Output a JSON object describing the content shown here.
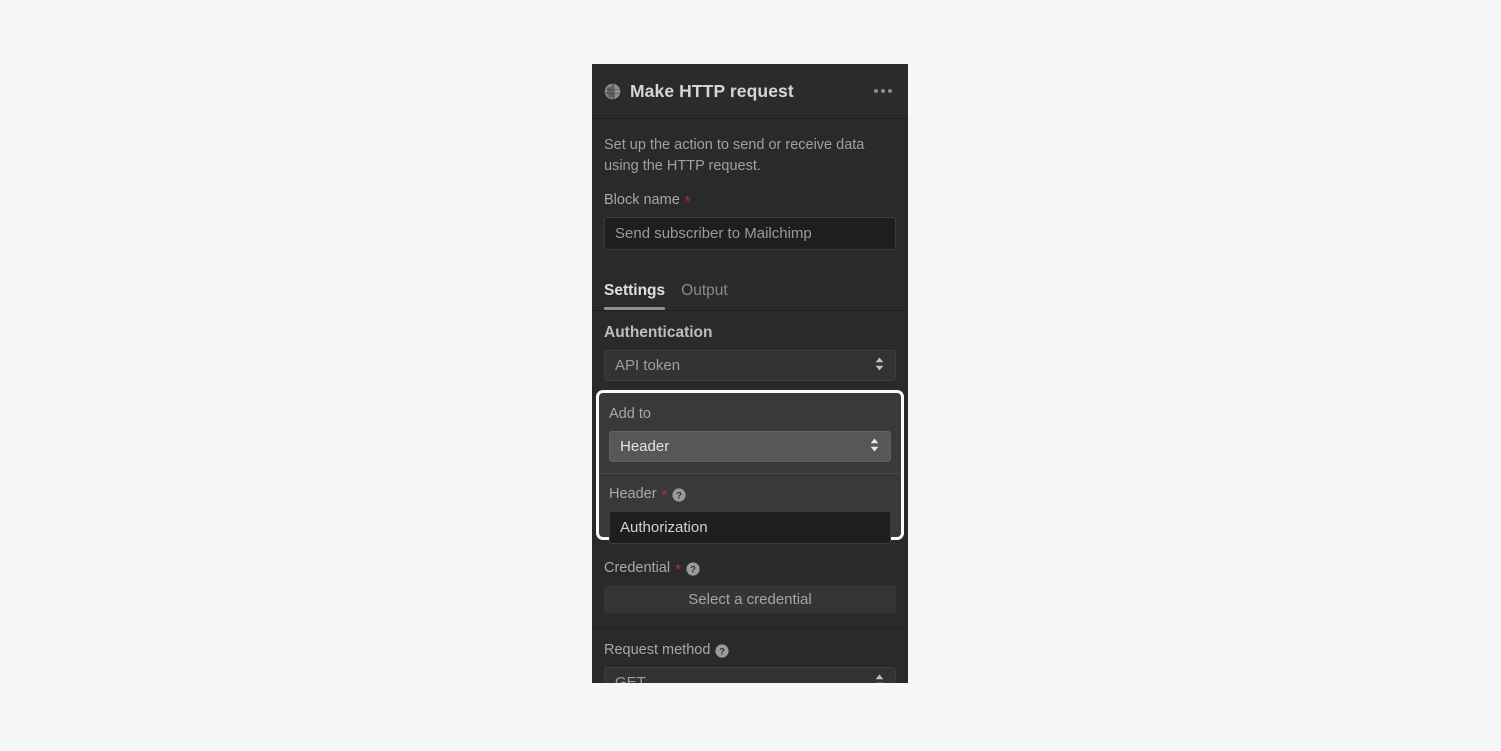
{
  "page": {
    "background_color": "#f5f6f8"
  },
  "panel": {
    "icon": "globe-icon",
    "title": "Make HTTP request",
    "overflow_menu": "kebab-menu-icon",
    "description": "Set up the action to send or receive data using the HTTP request.",
    "block_name": {
      "label": "Block name",
      "required_marker": "*",
      "value": "Send subscriber to Mailchimp",
      "is_placeholder": true
    },
    "tabs": [
      {
        "label": "Settings",
        "active": true
      },
      {
        "label": "Output",
        "active": false
      }
    ],
    "settings": {
      "authentication": {
        "title": "Authentication",
        "select_value": "API token",
        "indicator": "updown-chevron-icon"
      },
      "add_to": {
        "highlighted": true,
        "highlight_color": "#fbfbfb",
        "label": "Add to",
        "select_value": "Header",
        "indicator": "updown-chevron-icon",
        "header_field": {
          "label": "Header",
          "required_marker": "*",
          "help": "help-icon",
          "value": "Authorization"
        }
      },
      "credential": {
        "label": "Credential",
        "required_marker": "*",
        "help": "help-icon",
        "button_label": "Select a credential"
      },
      "request_method": {
        "label": "Request method",
        "help": "help-icon",
        "select_value": "GET",
        "indicator": "updown-chevron-icon"
      }
    }
  }
}
